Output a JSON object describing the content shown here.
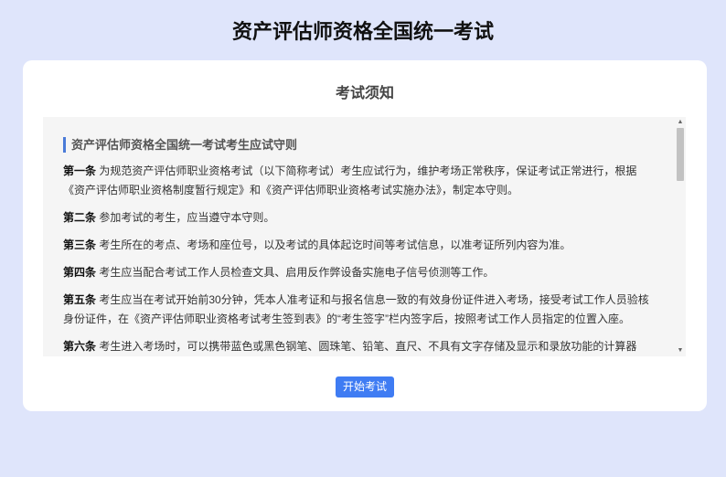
{
  "header": {
    "title": "资产评估师资格全国统一考试"
  },
  "card": {
    "title": "考试须知",
    "section_heading": "资产评估师资格全国统一考试考生应试守则",
    "articles": [
      {
        "label": "第一条",
        "text": " 为规范资产评估师职业资格考试（以下简称考试）考生应试行为，维护考场正常秩序，保证考试正常进行，根据《资产评估师职业资格制度暂行规定》和《资产评估师职业资格考试实施办法》，制定本守则。"
      },
      {
        "label": "第二条",
        "text": " 参加考试的考生，应当遵守本守则。"
      },
      {
        "label": "第三条",
        "text": " 考生所在的考点、考场和座位号，以及考试的具体起讫时间等考试信息，以准考证所列内容为准。"
      },
      {
        "label": "第四条",
        "text": " 考生应当配合考试工作人员检查文具、启用反作弊设备实施电子信号侦测等工作。"
      },
      {
        "label": "第五条",
        "text": " 考生应当在考试开始前30分钟，凭本人准考证和与报名信息一致的有效身份证件进入考场，接受考试工作人员验核身份证件，在《资产评估师职业资格考试考生签到表》的“考生签字”栏内签字后，按照考试工作人员指定的位置入座。"
      },
      {
        "label": "第六条",
        "text": " 考生进入考场时，可以携带蓝色或黑色钢笔、圆珠笔、铅笔、直尺、不具有文字存储及显示和录放功能的计算器"
      }
    ],
    "start_button": "开始考试"
  },
  "icons": {
    "scroll_up": "scroll-up-arrow-icon",
    "scroll_down": "scroll-down-arrow-icon"
  }
}
